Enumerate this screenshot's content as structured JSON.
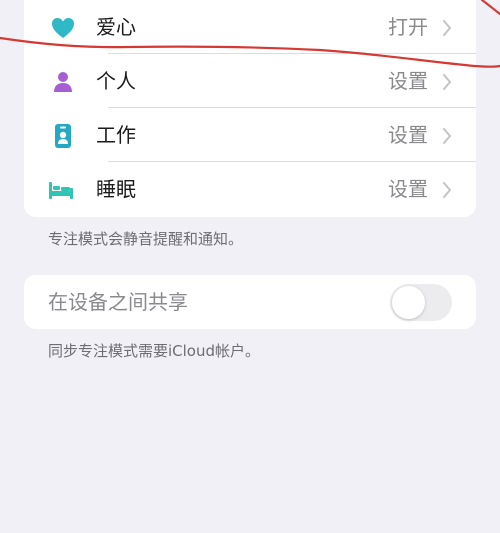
{
  "focus_modes": [
    {
      "label": "爱心",
      "value": "打开",
      "icon": "heart-icon",
      "color": "#2fb9c6"
    },
    {
      "label": "个人",
      "value": "设置",
      "icon": "person-icon",
      "color": "#a65ed4"
    },
    {
      "label": "工作",
      "value": "设置",
      "icon": "id-badge-icon",
      "color": "#24a9c2"
    },
    {
      "label": "睡眠",
      "value": "设置",
      "icon": "bed-icon",
      "color": "#2ec4b6"
    }
  ],
  "focus_footnote": "专注模式会静音提醒和通知。",
  "share": {
    "label": "在设备之间共享",
    "toggle_on": false,
    "footnote": "同步专注模式需要iCloud帐户。"
  },
  "colors": {
    "background": "#f1f0f6",
    "card": "#ffffff",
    "annotation_stroke": "#d43a33"
  }
}
